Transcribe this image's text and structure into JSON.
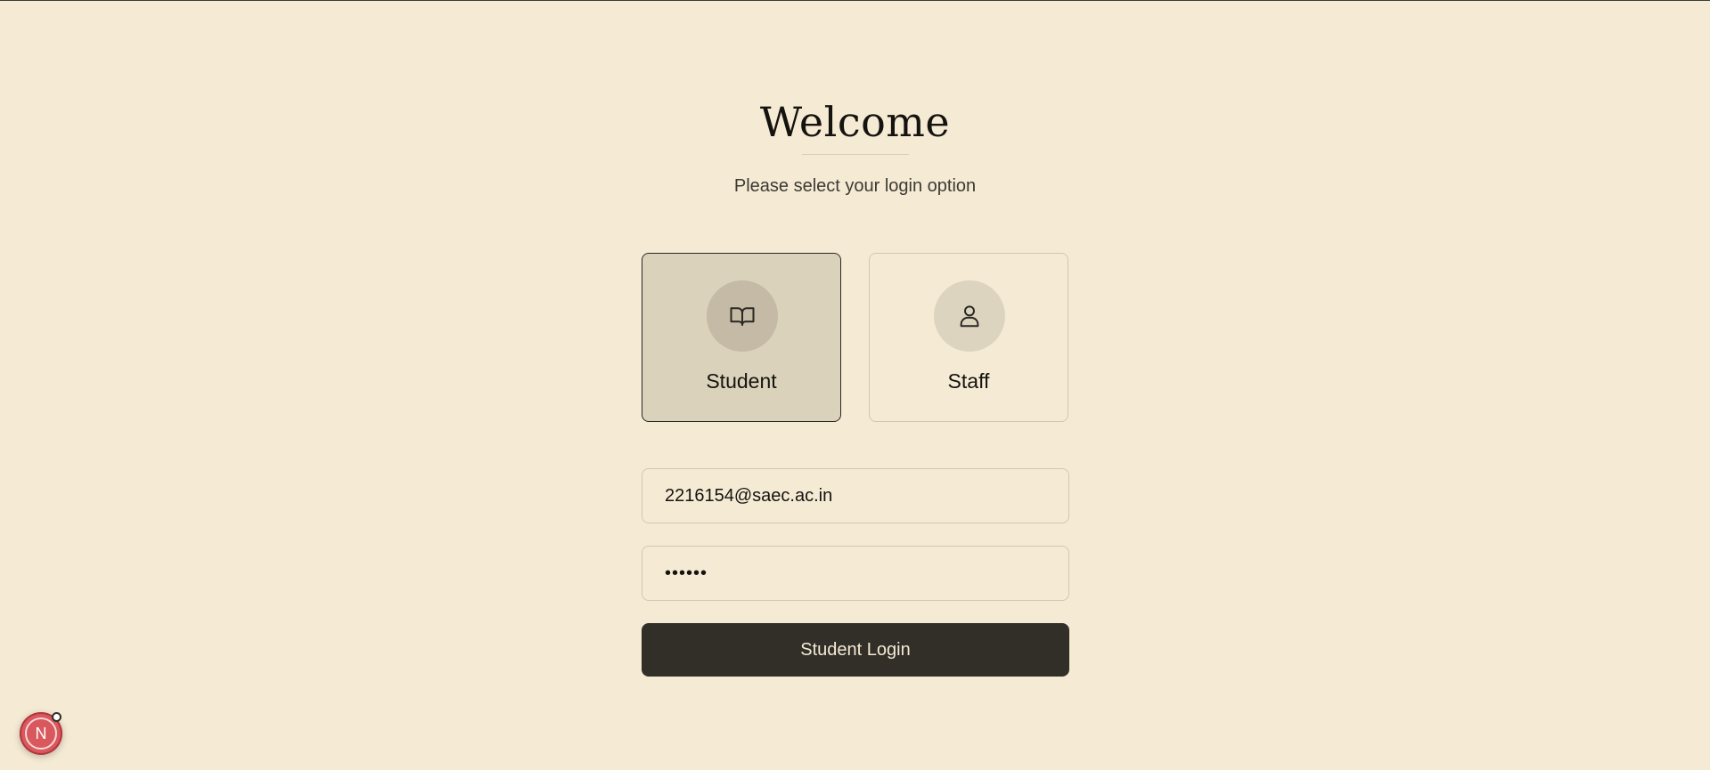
{
  "header": {
    "title": "Welcome",
    "subtitle": "Please select your login option"
  },
  "options": [
    {
      "label": "Student",
      "icon": "book-open-icon",
      "selected": true
    },
    {
      "label": "Staff",
      "icon": "user-icon",
      "selected": false
    }
  ],
  "form": {
    "email_value": "2216154@saec.ac.in",
    "password_value": "••••••",
    "submit_label": "Student Login"
  },
  "dev_badge": {
    "label": "N",
    "icon": "nextjs-devtools-icon"
  },
  "colors": {
    "background": "#f5ead4",
    "selected_card": "#dbd2bb",
    "button": "#312f28",
    "badge": "#d9585d"
  }
}
